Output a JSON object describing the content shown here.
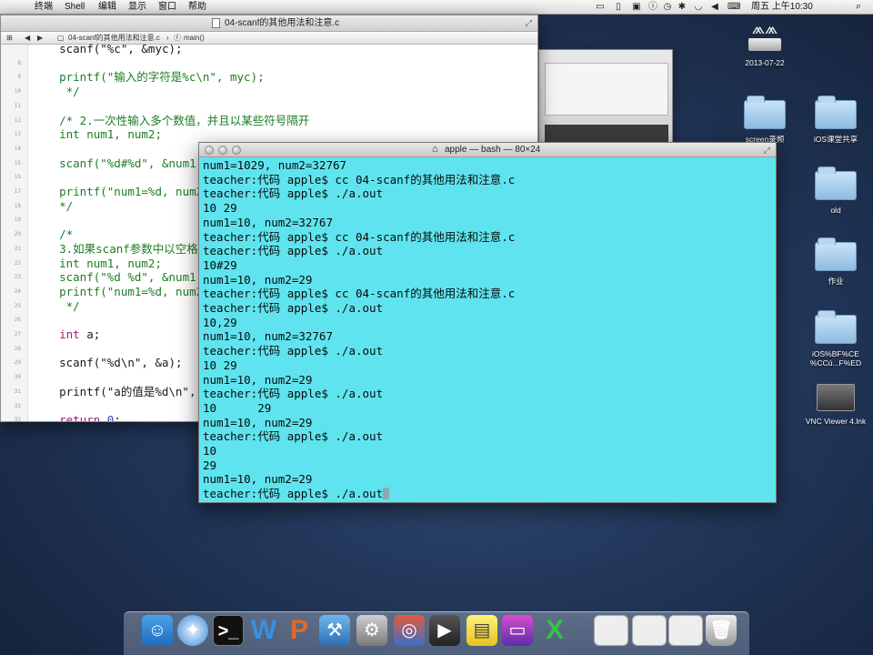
{
  "menubar": {
    "items": [
      "终端",
      "Shell",
      "编辑",
      "显示",
      "窗口",
      "帮助"
    ],
    "clock": "周五 上午10:30"
  },
  "editor": {
    "title": "04-scanf的其他用法和注意.c",
    "breadcrumb_file": "04-scanf的其他用法和注意.c",
    "breadcrumb_symbol": "main()",
    "lines": [
      {
        "n": "",
        "t": "    scanf(\"%c\", &myc);",
        "c": ""
      },
      {
        "n": "8",
        "t": "",
        "c": ""
      },
      {
        "n": "9",
        "t": "    printf(\"输入的字符是%c\\n\", myc);",
        "c": "c-comment"
      },
      {
        "n": "10",
        "t": "     */",
        "c": "c-comment"
      },
      {
        "n": "11",
        "t": "",
        "c": ""
      },
      {
        "n": "12",
        "t": "    /* 2.一次性输入多个数值，并且以某些符号隔开",
        "c": "c-comment"
      },
      {
        "n": "13",
        "t": "    int num1, num2;",
        "c": "c-comment"
      },
      {
        "n": "14",
        "t": "",
        "c": ""
      },
      {
        "n": "15",
        "t": "    scanf(\"%d#%d\", &num1, ",
        "c": "c-comment"
      },
      {
        "n": "16",
        "t": "",
        "c": ""
      },
      {
        "n": "17",
        "t": "    printf(\"num1=%d, num2",
        "c": "c-comment"
      },
      {
        "n": "18",
        "t": "    */",
        "c": "c-comment"
      },
      {
        "n": "19",
        "t": "",
        "c": ""
      },
      {
        "n": "20",
        "t": "    /*",
        "c": "c-comment"
      },
      {
        "n": "21",
        "t": "    3.如果scanf参数中以空格",
        "c": "c-comment"
      },
      {
        "n": "22",
        "t": "    int num1, num2;",
        "c": "c-comment"
      },
      {
        "n": "23",
        "t": "    scanf(\"%d %d\", &num1,",
        "c": "c-comment"
      },
      {
        "n": "24",
        "t": "    printf(\"num1=%d, num2",
        "c": "c-comment"
      },
      {
        "n": "25",
        "t": "     */",
        "c": "c-comment"
      },
      {
        "n": "26",
        "t": "",
        "c": ""
      },
      {
        "n": "27",
        "t": "    int a;",
        "c": ""
      },
      {
        "n": "28",
        "t": "",
        "c": ""
      },
      {
        "n": "29",
        "t": "    scanf(\"%d\\n\", &a);",
        "c": ""
      },
      {
        "n": "30",
        "t": "",
        "c": ""
      },
      {
        "n": "31",
        "t": "    printf(\"a的值是%d\\n\",",
        "c": ""
      },
      {
        "n": "32",
        "t": "",
        "c": ""
      },
      {
        "n": "33",
        "t": "    return 0;",
        "c": ""
      },
      {
        "n": "34",
        "t": "}",
        "c": ""
      }
    ]
  },
  "terminal": {
    "title": "apple — bash — 80×24",
    "lines": [
      "num1=1029, num2=32767",
      "teacher:代码 apple$ cc 04-scanf的其他用法和注意.c",
      "teacher:代码 apple$ ./a.out",
      "10 29",
      "num1=10, num2=32767",
      "teacher:代码 apple$ cc 04-scanf的其他用法和注意.c",
      "teacher:代码 apple$ ./a.out",
      "10#29",
      "num1=10, num2=29",
      "teacher:代码 apple$ cc 04-scanf的其他用法和注意.c",
      "teacher:代码 apple$ ./a.out",
      "10,29",
      "num1=10, num2=32767",
      "teacher:代码 apple$ ./a.out",
      "10 29",
      "num1=10, num2=29",
      "teacher:代码 apple$ ./a.out",
      "10      29",
      "num1=10, num2=29",
      "teacher:代码 apple$ ./a.out",
      "10",
      "29",
      "num1=10, num2=29",
      "teacher:代码 apple$ ./a.out"
    ]
  },
  "desktop": {
    "drive_label": "2013-07-22",
    "folders": [
      {
        "label": "screen录频"
      },
      {
        "label": "iOS课堂共享"
      },
      {
        "label": "old"
      },
      {
        "label": "作业"
      },
      {
        "label": "iOS%BF%CE %CCú...F%ED"
      }
    ],
    "vnc_label": "VNC Viewer 4.lnk"
  }
}
